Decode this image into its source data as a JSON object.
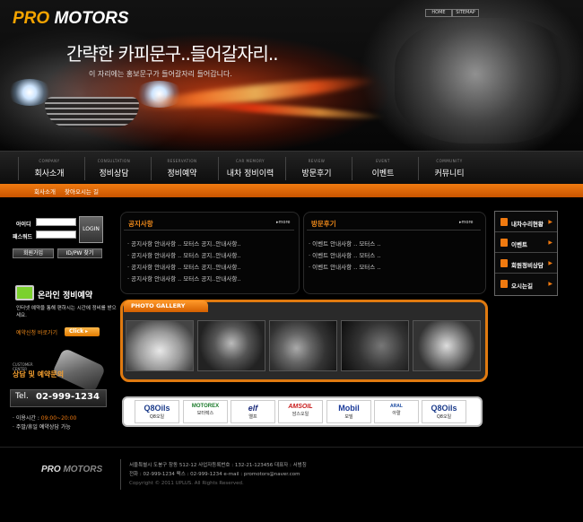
{
  "brand": {
    "logo_a": "PRO",
    "logo_b": "MOTORS"
  },
  "toplinks": [
    "HOME",
    "SITEMAP"
  ],
  "hero": {
    "title": "간략한 카피문구..들어갈자리..",
    "subtitle": "이 자리에는 홍보문구가 들어갈자리 들어갑니다."
  },
  "nav": [
    {
      "en": "COMPANY",
      "ko": "회사소개"
    },
    {
      "en": "CONSULTATION",
      "ko": "정비상담"
    },
    {
      "en": "RESERVATION",
      "ko": "정비예약"
    },
    {
      "en": "CAR MEMORY",
      "ko": "내차 정비이력"
    },
    {
      "en": "REVIEW",
      "ko": "방문후기"
    },
    {
      "en": "EVENT",
      "ko": "이벤트"
    },
    {
      "en": "COMMUNITY",
      "ko": "커뮤니티"
    }
  ],
  "subnav": [
    "회사소개",
    "찾아오시는 길"
  ],
  "login": {
    "id_label": "아이디",
    "pw_label": "패스워드",
    "login_btn": "LOGIN",
    "join_btn": "회원가입",
    "find_btn": "ID/PW 찾기"
  },
  "online": {
    "title": "온라인 정비예약",
    "desc": "인터넷 예약을 통해 편하시는 시간에 정비를 받으세요.",
    "link": "예약신청 바로가기",
    "click": "Click"
  },
  "customer": {
    "en_line1": "CUSTOMER",
    "en_line2": "CENTER",
    "ko": "상담 및 예약문의",
    "tel_label": "Tel.",
    "tel": "02-999-1234",
    "hours_label": "이용시간 :",
    "hours": "09:00~20:00",
    "note": "주말/휴일 예약상담 가능"
  },
  "notice": {
    "title": "공지사항",
    "more": "more",
    "items": [
      "공지사항 안내사항 .. 모터스 공지..안내사항..",
      "공지사항 안내사항 .. 모터스 공지..안내사항..",
      "공지사항 안내사항 .. 모터스 공지..안내사항..",
      "공지사항 안내사항 .. 모터스 공지..안내사항.."
    ]
  },
  "review": {
    "title": "방문후기",
    "more": "more",
    "items": [
      "이벤트 안내사항 .. 모터스 ..",
      "이벤트 안내사항 .. 모터스 ..",
      "이벤트 안내사항 .. 모터스 .."
    ]
  },
  "quick": [
    "내차수리현황",
    "이벤트",
    "회원정비상담",
    "오시는길"
  ],
  "gallery": {
    "title": "PHOTO GALLERY"
  },
  "partners": [
    {
      "logo": "Q8Oils",
      "name": "Q8오일",
      "color": "#1b3b8a"
    },
    {
      "logo": "MOTOREX",
      "name": "모터렉스",
      "color": "#1a7a2a"
    },
    {
      "logo": "elf",
      "name": "엘프",
      "color": "#1a2a7a"
    },
    {
      "logo": "AMSOIL",
      "name": "암스오일",
      "color": "#c81a1a"
    },
    {
      "logo": "Mobil",
      "name": "모빌",
      "color": "#1a3a9a"
    },
    {
      "logo": "ARAL",
      "name": "아랄",
      "color": "#1a4aa0"
    },
    {
      "logo": "Q8Oils",
      "name": "Q8오일",
      "color": "#1b3b8a"
    }
  ],
  "footer": {
    "logo_a": "PRO",
    "logo_b": "MOTORS",
    "line1": "서울특별시 도봉구 창동 512-12    사업자등록번호 : 132-21-123456    대표자 : 서범칭",
    "line2": "전화 : 02-999-1234    팩스 : 02-999-1234    e-mail : promotors@naver.com",
    "line3": "Copyright © 2011 UPLUS. All Rights Reserved."
  }
}
